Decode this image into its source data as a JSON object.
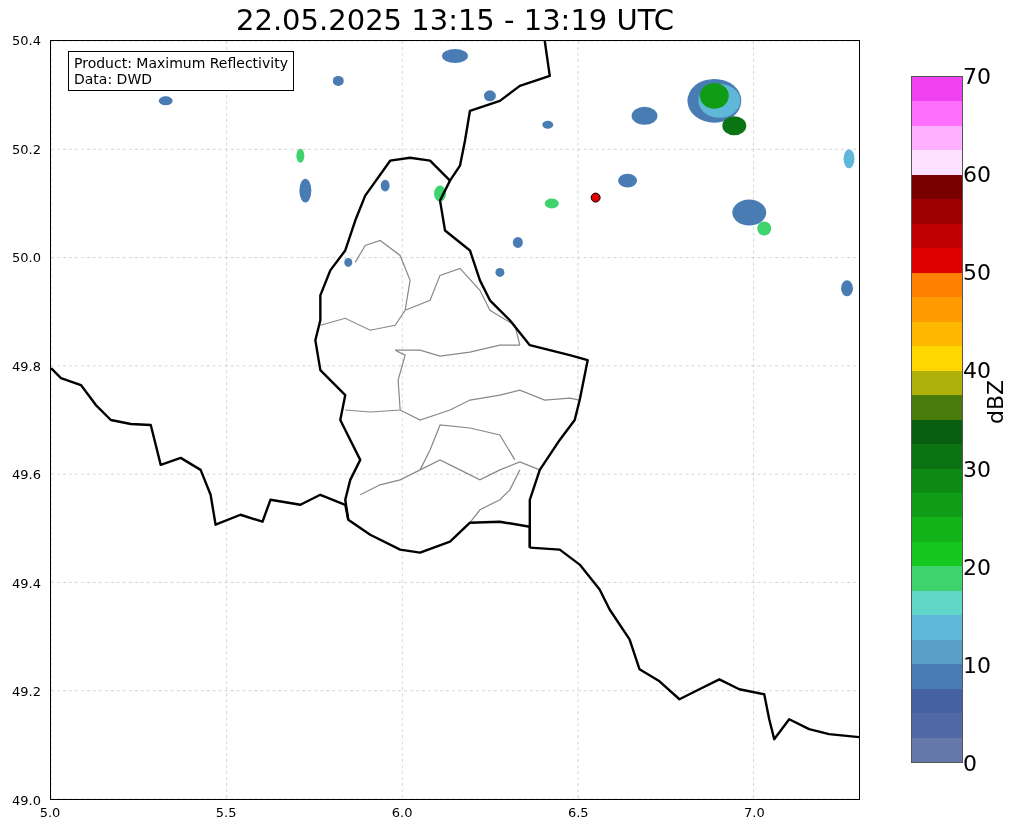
{
  "title": "22.05.2025 13:15 - 13:19 UTC",
  "map": {
    "x_ticks": [
      "5.0",
      "5.5",
      "6.0",
      "6.5",
      "7.0"
    ],
    "y_ticks": [
      "50.4",
      "50.2",
      "50.0",
      "49.8",
      "49.6",
      "49.4",
      "49.2",
      "49.0"
    ],
    "marker": {
      "color": "#e00000"
    }
  },
  "info_box": {
    "lines": [
      "Product: Maximum Reflectivity",
      "Data: DWD"
    ]
  },
  "colorbar": {
    "label": "dBZ",
    "ticks": [
      "70",
      "60",
      "50",
      "40",
      "30",
      "20",
      "10",
      "0"
    ],
    "bands": [
      {
        "color": "#f040f0"
      },
      {
        "color": "#ff70ff"
      },
      {
        "color": "#ffb0ff"
      },
      {
        "color": "#ffe0ff"
      },
      {
        "color": "#7a0000"
      },
      {
        "color": "#9c0000"
      },
      {
        "color": "#c00000"
      },
      {
        "color": "#e00000"
      },
      {
        "color": "#ff7f00"
      },
      {
        "color": "#ff9b00"
      },
      {
        "color": "#ffb800"
      },
      {
        "color": "#ffd700"
      },
      {
        "color": "#b0b00a"
      },
      {
        "color": "#4a7a0b"
      },
      {
        "color": "#095e10"
      },
      {
        "color": "#0b7412"
      },
      {
        "color": "#0d8a13"
      },
      {
        "color": "#0f9c16"
      },
      {
        "color": "#12b419"
      },
      {
        "color": "#14c81e"
      },
      {
        "color": "#3fd36e"
      },
      {
        "color": "#62d6c8"
      },
      {
        "color": "#60b8d8"
      },
      {
        "color": "#5a9fc8"
      },
      {
        "color": "#4a7cb4"
      },
      {
        "color": "#4462a2"
      },
      {
        "color": "#5068a6"
      },
      {
        "color": "#6478aa"
      }
    ]
  }
}
